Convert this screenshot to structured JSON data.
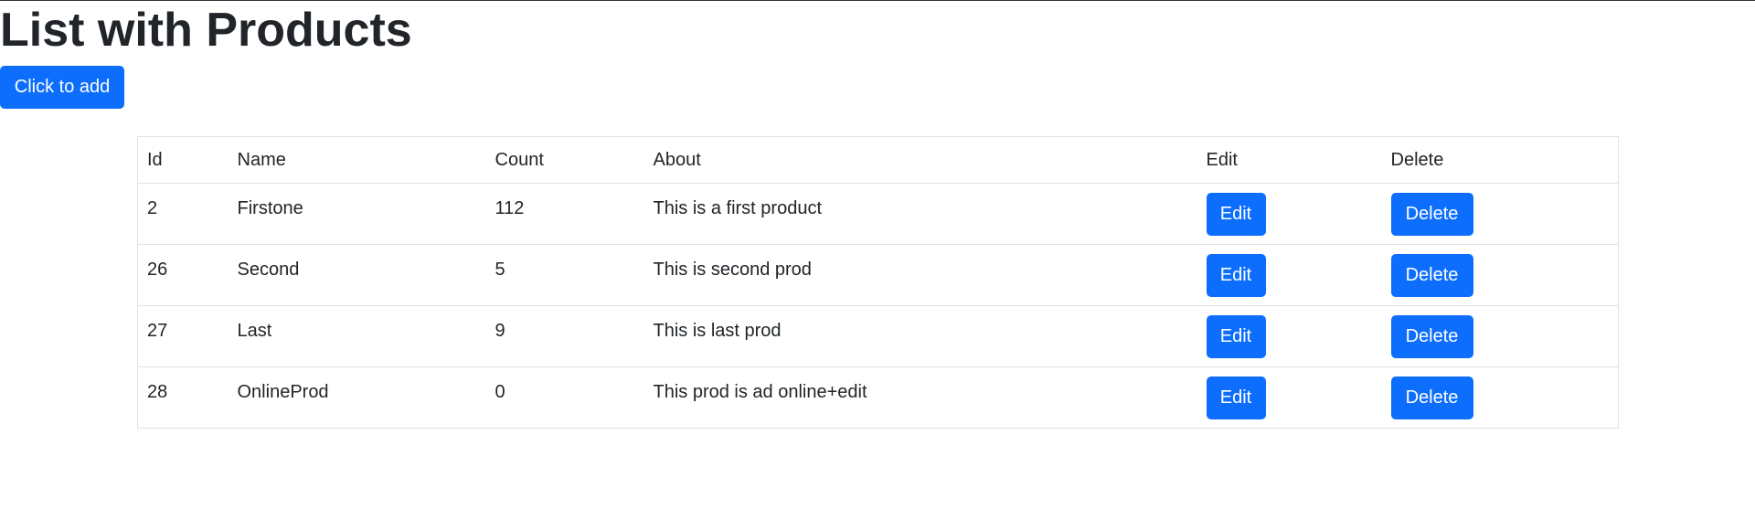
{
  "page": {
    "title": "List with Products",
    "add_button_label": "Click to add"
  },
  "colors": {
    "accent": "#0d6efd",
    "text": "#212529",
    "border": "#dee2e6"
  },
  "table": {
    "headers": {
      "id": "Id",
      "name": "Name",
      "count": "Count",
      "about": "About",
      "edit": "Edit",
      "delete": "Delete"
    },
    "rows": [
      {
        "id": "2",
        "name": "Firstone",
        "count": "112",
        "about": "This is a first product",
        "edit_label": "Edit",
        "delete_label": "Delete"
      },
      {
        "id": "26",
        "name": "Second",
        "count": "5",
        "about": "This is second prod",
        "edit_label": "Edit",
        "delete_label": "Delete"
      },
      {
        "id": "27",
        "name": "Last",
        "count": "9",
        "about": "This is last prod",
        "edit_label": "Edit",
        "delete_label": "Delete"
      },
      {
        "id": "28",
        "name": "OnlineProd",
        "count": "0",
        "about": "This prod is ad online+edit",
        "edit_label": "Edit",
        "delete_label": "Delete"
      }
    ]
  }
}
